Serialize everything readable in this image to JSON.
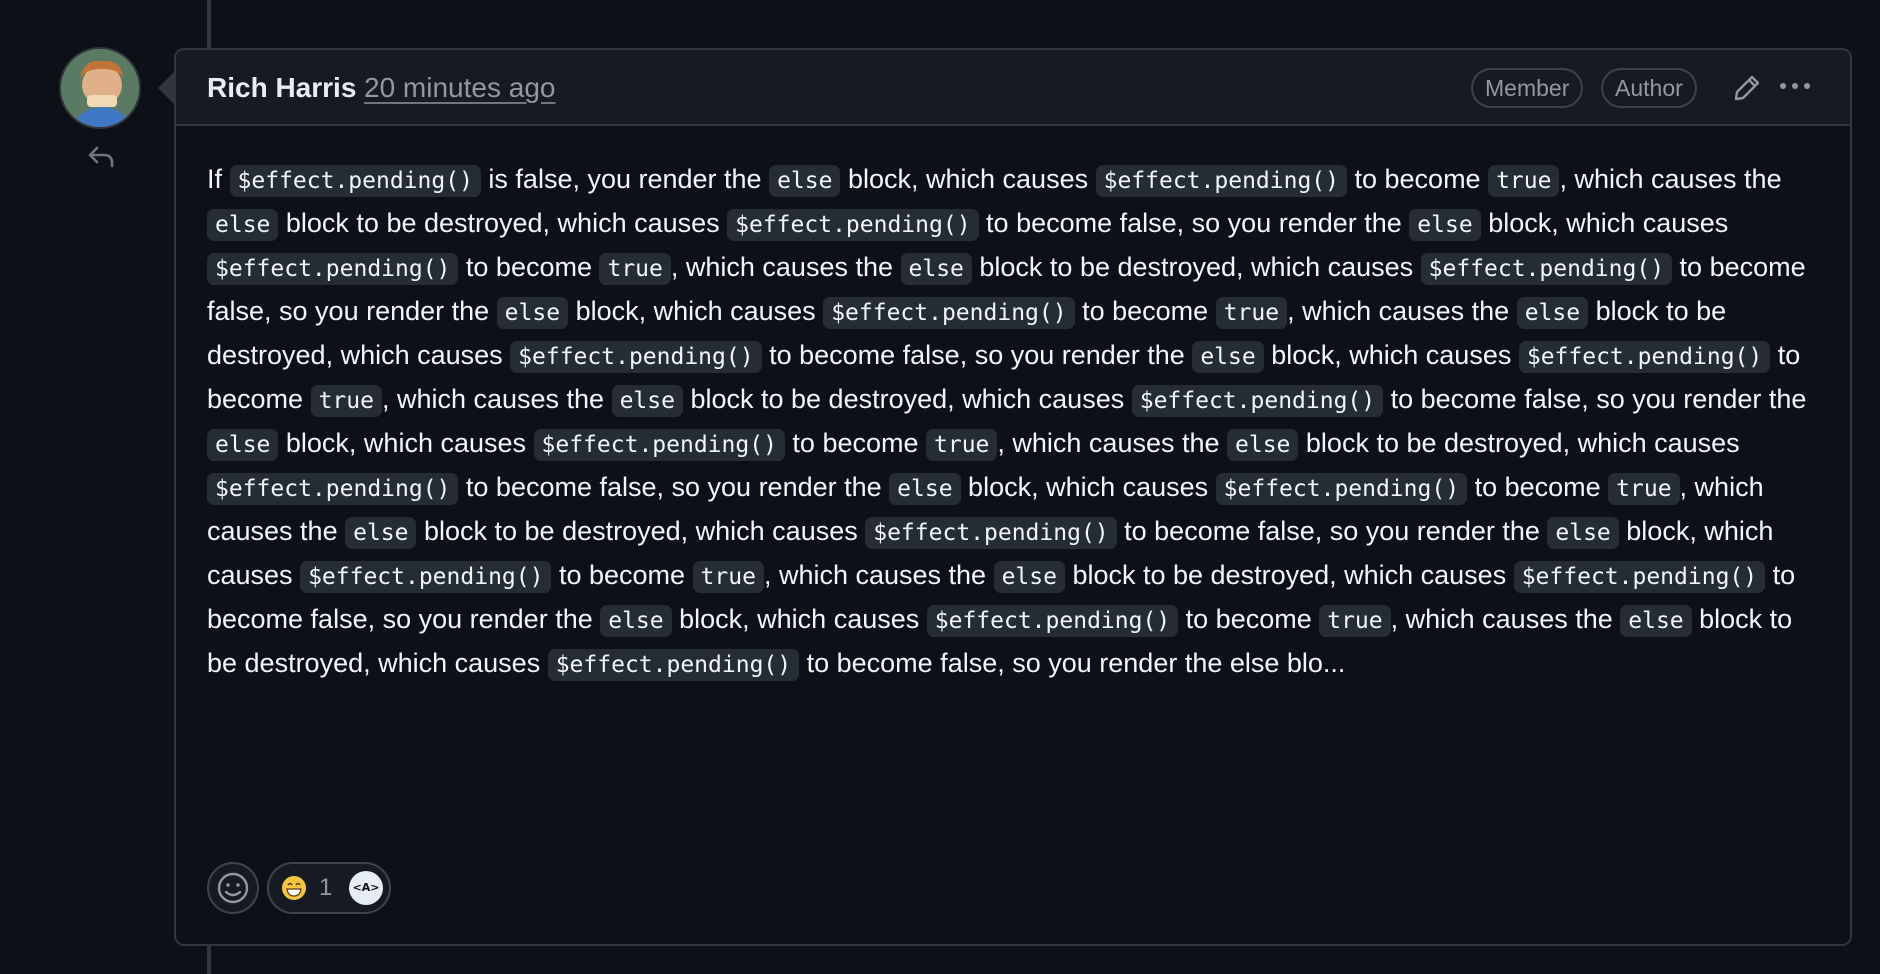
{
  "comment": {
    "author": "Rich Harris",
    "timestamp": "20 minutes ago",
    "badges": [
      "Member",
      "Author"
    ],
    "body_prefix": "If",
    "loop_code": "$effect.pending()",
    "else_code": "else",
    "true_code": "true",
    "body_text": "If $effect.pending() is false, you render the else block, which causes $effect.pending() to become true, which causes the else block to be destroyed, which causes $effect.pending() to become false, so you render the else block, which causes $effect.pending() to become true, which causes the else block to be destroyed, which causes $effect.pending() to become false, so you render the else block, which causes $effect.pending() to become true, which causes the else block to be destroyed, which causes $effect.pending() to become false, so you render the else block, which causes $effect.pending() to become true, which causes the else block to be destroyed, which causes $effect.pending() to become false, so you render the else block, which causes $effect.pending() to become true, which causes the else block to be destroyed, which causes $effect.pending() to become false, so you render the else block, which causes $effect.pending() to become true, which causes the else block to be destroyed, which causes $effect.pending() to become false, so you render the else block, which causes $effect.pending() to become true, which causes the else block to be destroyed, which causes $effect.pending() to become false, so you render the else block, which causes $effect.pending() to become true, which causes the else block to be destroyed, which causes $effect.pending() to become false, so you render the else blo...",
    "truncated_tail": "blo..."
  },
  "reactions": {
    "emoji": "grinning-face-with-smiling-eyes",
    "count": "1",
    "reactor_initials": "<A>"
  },
  "icons": {
    "reply": "reply-icon",
    "edit": "pencil-icon",
    "more": "kebab-horizontal-icon",
    "add_reaction": "smiley-icon"
  },
  "colors": {
    "background": "#0d1117",
    "header_bg": "#161b22",
    "border": "#30363d",
    "muted_text": "#9198a1",
    "code_bg": "#262c36"
  }
}
